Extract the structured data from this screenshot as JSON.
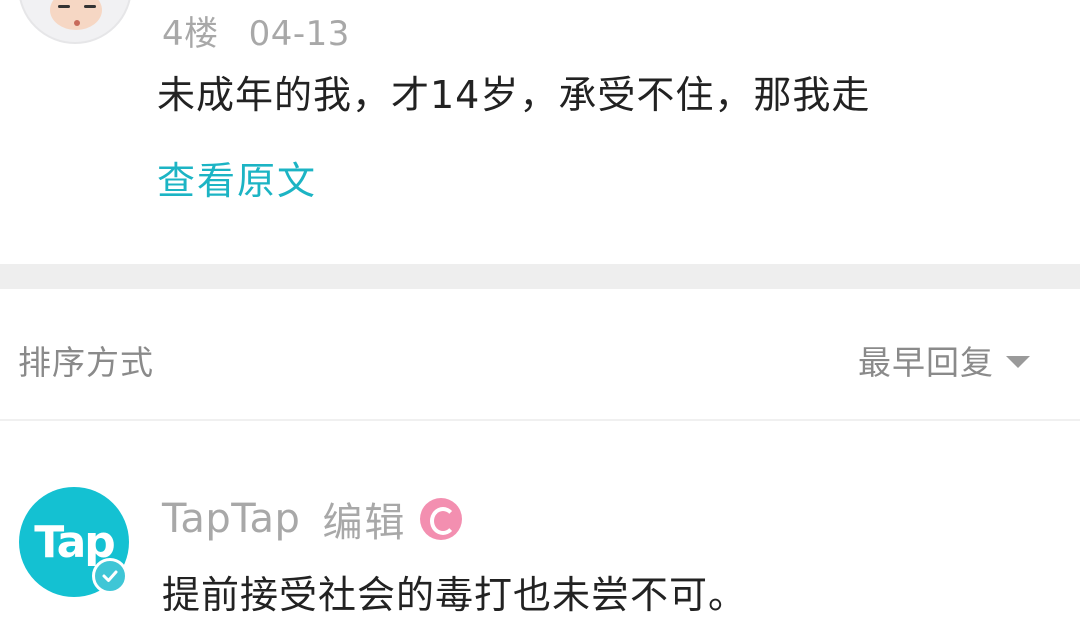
{
  "top_comment": {
    "floor": "4楼",
    "date": "04-13",
    "text": "未成年的我，才14岁，承受不住，那我走",
    "view_original": "查看原文"
  },
  "sort_bar": {
    "label": "排序方式",
    "selected": "最早回复"
  },
  "official_comment": {
    "avatar_text": "Tap",
    "author": "TapTap",
    "role": "编辑",
    "text": "提前接受社会的毒打也未尝不可。"
  },
  "colors": {
    "accent": "#1cb4c4",
    "brand": "#14c1d2",
    "muted_text": "#a8a8a8",
    "body_text": "#222222",
    "badge_pink": "#f38fb0"
  }
}
